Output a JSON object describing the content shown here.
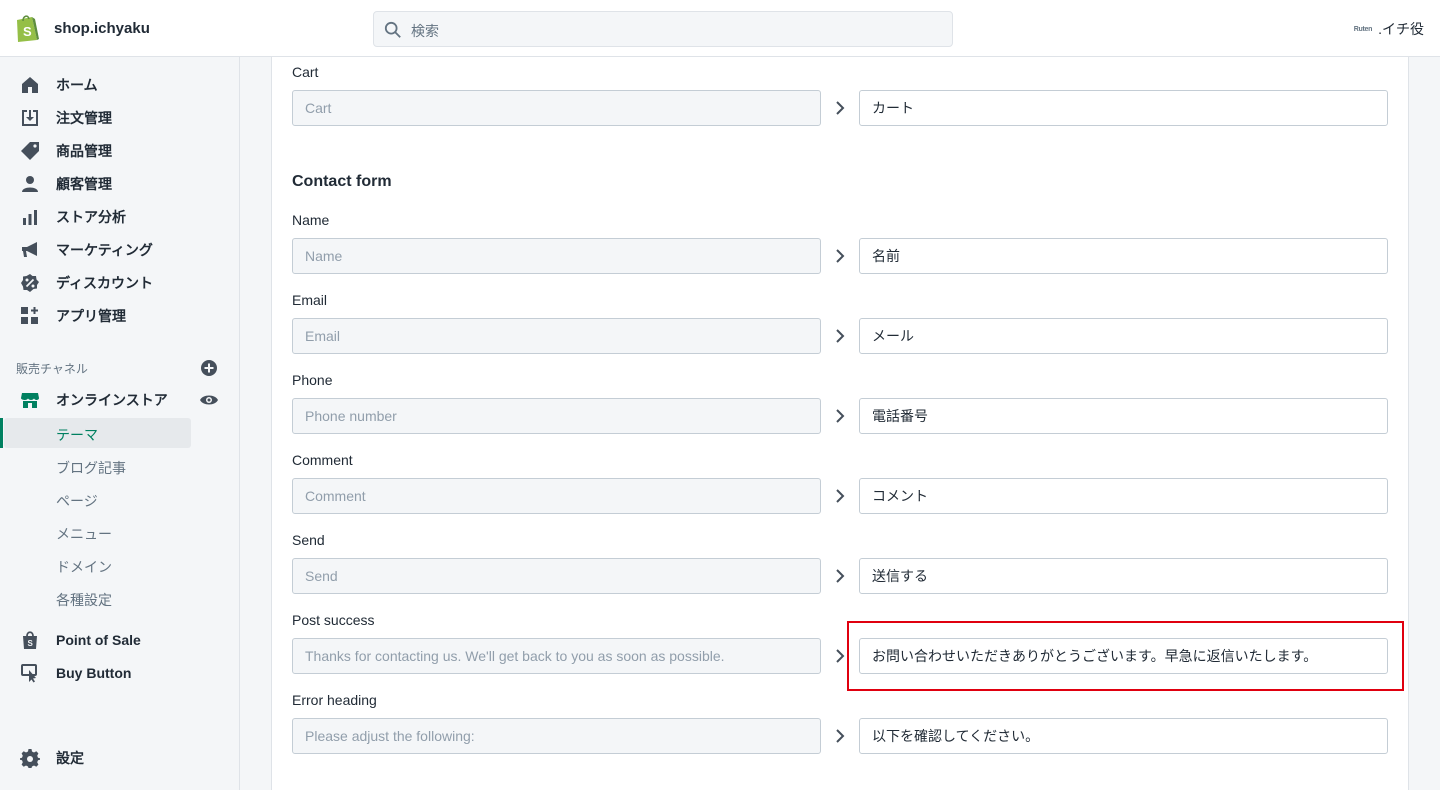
{
  "topbar": {
    "shop_name": "shop.ichyaku",
    "search_placeholder": "検索",
    "account_logo": "Ruten",
    "account_name": ".イチ役"
  },
  "sidebar": {
    "items": [
      {
        "label": "ホーム",
        "icon": "home-icon"
      },
      {
        "label": "注文管理",
        "icon": "orders-icon"
      },
      {
        "label": "商品管理",
        "icon": "tag-icon"
      },
      {
        "label": "顧客管理",
        "icon": "person-icon"
      },
      {
        "label": "ストア分析",
        "icon": "analytics-icon"
      },
      {
        "label": "マーケティング",
        "icon": "megaphone-icon"
      },
      {
        "label": "ディスカウント",
        "icon": "discount-icon"
      },
      {
        "label": "アプリ管理",
        "icon": "apps-icon"
      }
    ],
    "channels_label": "販売チャネル",
    "online_store": "オンラインストア",
    "sub_items": [
      "テーマ",
      "ブログ記事",
      "ページ",
      "メニュー",
      "ドメイン",
      "各種設定"
    ],
    "point_of_sale": "Point of Sale",
    "buy_button": "Buy Button",
    "settings": "設定"
  },
  "main": {
    "cart": {
      "label": "Cart",
      "source": "Cart",
      "value": "カート"
    },
    "contact_heading": "Contact form",
    "fields": [
      {
        "label": "Name",
        "source": "Name",
        "value": "名前"
      },
      {
        "label": "Email",
        "source": "Email",
        "value": "メール"
      },
      {
        "label": "Phone",
        "source": "Phone number",
        "value": "電話番号"
      },
      {
        "label": "Comment",
        "source": "Comment",
        "value": "コメント"
      },
      {
        "label": "Send",
        "source": "Send",
        "value": "送信する"
      },
      {
        "label": "Post success",
        "source": "Thanks for contacting us. We'll get back to you as soon as possible.",
        "value": "お問い合わせいただきありがとうございます。早急に返信いたします。"
      },
      {
        "label": "Error heading",
        "source": "Please adjust the following:",
        "value": "以下を確認してください。"
      }
    ]
  },
  "colors": {
    "accent": "#008060",
    "highlight": "#e0000f",
    "brand": "#95bf47"
  }
}
